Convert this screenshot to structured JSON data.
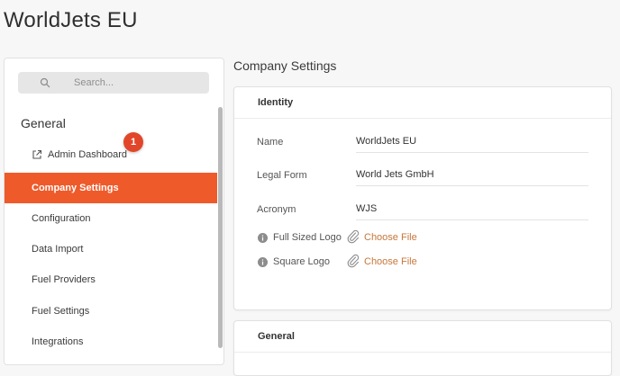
{
  "app": {
    "title": "WorldJets EU"
  },
  "sidebar": {
    "search_placeholder": "Search...",
    "group_heading": "General",
    "badge_count": "1",
    "items": [
      {
        "label": "Admin Dashboard",
        "icon": "external-link-icon"
      },
      {
        "label": "Company Settings",
        "active": true
      },
      {
        "label": "Configuration"
      },
      {
        "label": "Data Import"
      },
      {
        "label": "Fuel Providers"
      },
      {
        "label": "Fuel Settings"
      },
      {
        "label": "Integrations"
      }
    ]
  },
  "main": {
    "section_title": "Company Settings",
    "identity": {
      "header": "Identity",
      "fields": [
        {
          "label": "Name",
          "value": "WorldJets EU"
        },
        {
          "label": "Legal Form",
          "value": "World Jets GmbH"
        },
        {
          "label": "Acronym",
          "value": "WJS"
        }
      ],
      "files": [
        {
          "label": "Full Sized Logo",
          "action": "Choose File"
        },
        {
          "label": "Square Logo",
          "action": "Choose File"
        }
      ]
    },
    "general": {
      "header": "General"
    }
  },
  "colors": {
    "accent": "#ef5a2a",
    "badge": "#e2462a",
    "link": "#c7773a"
  }
}
